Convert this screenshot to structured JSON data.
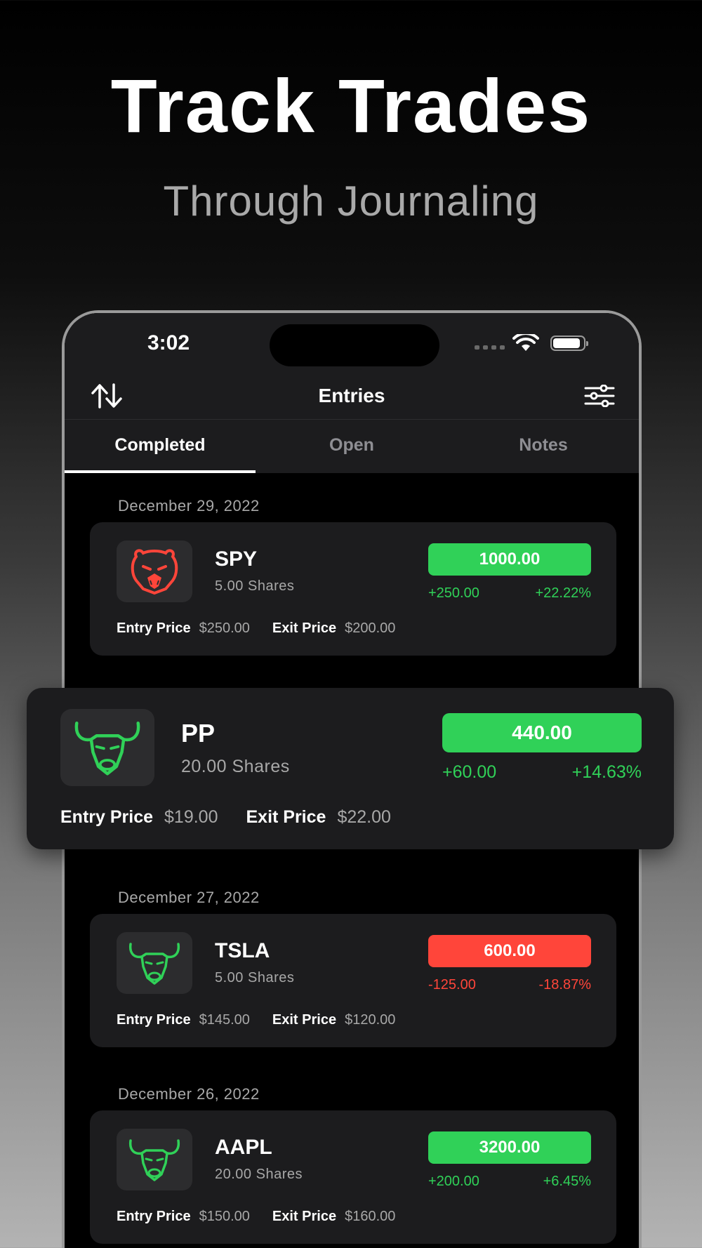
{
  "hero": {
    "title": "Track Trades",
    "subtitle": "Through Journaling"
  },
  "status_bar": {
    "time": "3:02"
  },
  "nav": {
    "title": "Entries"
  },
  "tabs": [
    {
      "label": "Completed",
      "active": true
    },
    {
      "label": "Open",
      "active": false
    },
    {
      "label": "Notes",
      "active": false
    }
  ],
  "labels": {
    "entry_price": "Entry Price",
    "exit_price": "Exit Price"
  },
  "colors": {
    "gain": "#30d158",
    "loss": "#ff453a",
    "card": "#1c1c1e",
    "bear_icon": "#ff453a",
    "bull_icon": "#30d158"
  },
  "groups": [
    {
      "date": "December 29, 2022",
      "entries": [
        {
          "ticker": "SPY",
          "shares": "5.00 Shares",
          "value": "1000.00",
          "change": "+250.00",
          "percent": "+22.22%",
          "entry_price": "$250.00",
          "exit_price": "$200.00",
          "icon": "bear-icon",
          "direction": "gain"
        }
      ]
    },
    {
      "date": "December 27, 2022",
      "entries": [
        {
          "ticker": "TSLA",
          "shares": "5.00 Shares",
          "value": "600.00",
          "change": "-125.00",
          "percent": "-18.87%",
          "entry_price": "$145.00",
          "exit_price": "$120.00",
          "icon": "bull-icon",
          "direction": "loss"
        }
      ]
    },
    {
      "date": "December 26, 2022",
      "entries": [
        {
          "ticker": "AAPL",
          "shares": "20.00 Shares",
          "value": "3200.00",
          "change": "+200.00",
          "percent": "+6.45%",
          "entry_price": "$150.00",
          "exit_price": "$160.00",
          "icon": "bull-icon",
          "direction": "gain"
        }
      ]
    }
  ],
  "featured": {
    "ticker": "PP",
    "shares": "20.00 Shares",
    "value": "440.00",
    "change": "+60.00",
    "percent": "+14.63%",
    "entry_price": "$19.00",
    "exit_price": "$22.00",
    "icon": "bull-icon",
    "direction": "gain"
  }
}
